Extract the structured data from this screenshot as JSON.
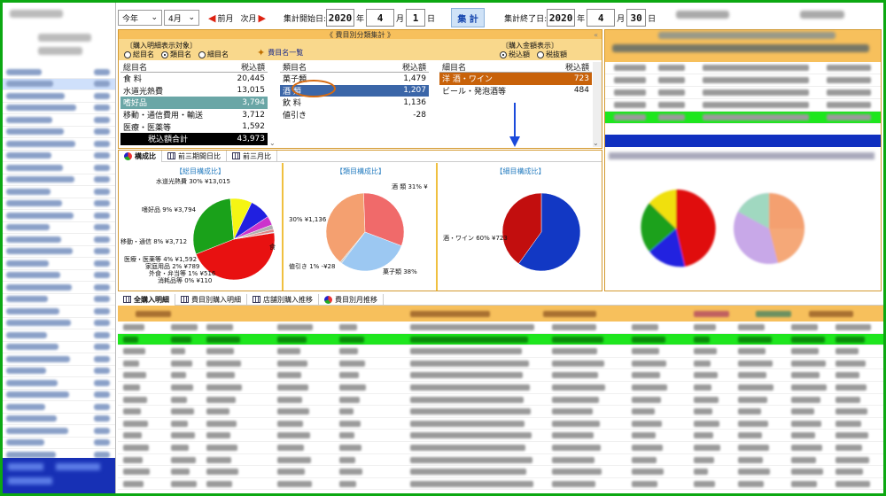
{
  "toolbar": {
    "period_select": "今年",
    "month_select": "4月",
    "prev_label": "前月",
    "next_label": "次月",
    "start_label": "集計開始日:",
    "start_year": "2020",
    "start_month": "4",
    "start_day": "1",
    "year_unit": "年",
    "month_unit": "月",
    "day_unit": "日",
    "aggregate_button": "集 計",
    "end_label": "集計終了日:",
    "end_year": "2020",
    "end_month": "4",
    "end_day": "30"
  },
  "summary": {
    "title": "《 費目別分類集計 》",
    "display_target_label": "〔購入明細表示対象〕",
    "radio_general": "総目名",
    "radio_category": "類目名",
    "radio_item": "細目名",
    "list_button": "費目名一覧",
    "amount_display_label": "〔購入金額表示〕",
    "radio_tax_incl": "税込額",
    "radio_tax_excl": "税抜額",
    "general_header": "総目名",
    "category_header": "類目名",
    "item_header": "細目名",
    "amount_header": "税込額",
    "general_rows": [
      {
        "name": "食 料",
        "value": "20,445"
      },
      {
        "name": "水道光熱費",
        "value": "13,015"
      },
      {
        "name": "嗜好品",
        "value": "3,794"
      },
      {
        "name": "移動・通信費用・輸送",
        "value": "3,712"
      },
      {
        "name": "医療・医薬等",
        "value": "1,592"
      }
    ],
    "total_label": "税込額合計",
    "total_value": "43,973",
    "category_rows": [
      {
        "name": "菓子類",
        "value": "1,479"
      },
      {
        "name": "酒 類",
        "value": "1,207"
      },
      {
        "name": "飲 料",
        "value": "1,136"
      },
      {
        "name": "値引き",
        "value": "-28"
      }
    ],
    "item_rows": [
      {
        "name": "洋 酒・ワイン",
        "value": "723"
      },
      {
        "name": "ビール・発泡酒等",
        "value": "484"
      }
    ]
  },
  "chart_tabs": [
    "構成比",
    "前三期間日比",
    "前三月比"
  ],
  "charts": {
    "general_title": "【総目構成比】",
    "category_title": "【類目構成比】",
    "item_title": "【細目構成比】",
    "general_labels": [
      "水道光熱費 30% ¥13,015",
      "嗜好品 9% ¥3,794",
      "移動・通信 8% ¥3,712",
      "医療・医薬等 4% ¥1,592",
      "家庭用品 2% ¥789",
      "外食・弁当等 1% ¥516",
      "消耗品等 0% ¥110",
      "食"
    ],
    "category_labels": [
      "酒 類 31% ¥",
      "30% ¥1,136",
      "値引き 1% -¥28",
      "菓子類 38%"
    ],
    "item_labels": [
      "酒・ワイン 60% ¥723"
    ]
  },
  "chart_data": [
    {
      "type": "pie",
      "title": "【総目構成比】",
      "categories": [
        "食料",
        "水道光熱費",
        "嗜好品",
        "移動・通信",
        "医療・医薬等",
        "家庭用品",
        "外食・弁当等",
        "消耗品等"
      ],
      "values": [
        20445,
        13015,
        3794,
        3712,
        1592,
        789,
        516,
        110
      ],
      "colors": [
        "#e81111",
        "#1aa11a",
        "#f5f513",
        "#2020e0",
        "#cc33cc",
        "#b0b0b0",
        "#dd8888",
        "#66aadd"
      ]
    },
    {
      "type": "pie",
      "title": "【類目構成比】",
      "categories": [
        "菓子類",
        "酒類",
        "飲料",
        "値引き"
      ],
      "values": [
        1479,
        1207,
        1136,
        28
      ],
      "colors": [
        "#f4a070",
        "#f06a6a",
        "#9cc8f2",
        "#cccccc"
      ]
    },
    {
      "type": "pie",
      "title": "【細目構成比】",
      "categories": [
        "洋酒・ワイン",
        "ビール・発泡酒等"
      ],
      "values": [
        723,
        484
      ],
      "colors": [
        "#1238c4",
        "#c20e0e"
      ]
    }
  ],
  "bottom_tabs": [
    "全購入明細",
    "費目別購入明細",
    "店舗別購入推移",
    "費目別月推移"
  ]
}
